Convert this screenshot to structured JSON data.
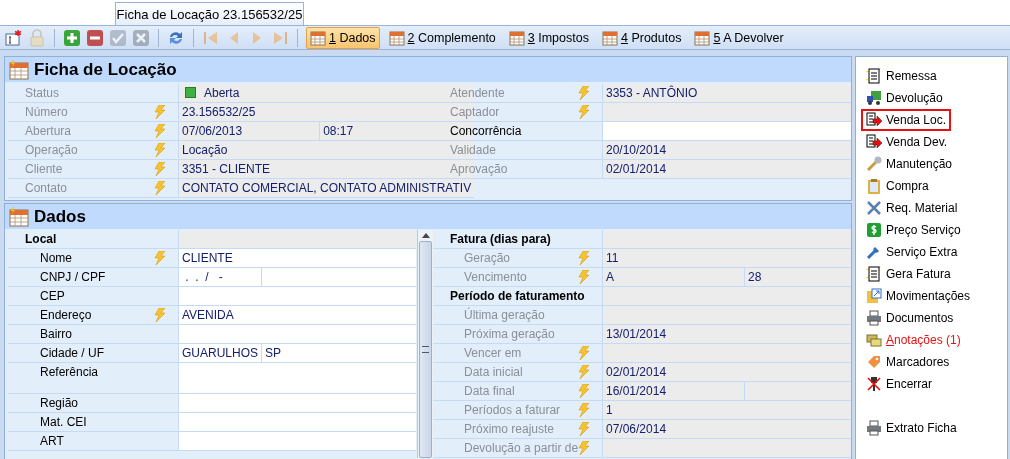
{
  "window": {
    "title": "Ficha de Locação 23.156532/25"
  },
  "toolbar": {
    "groups": [
      [
        {
          "kind": "new",
          "disabled": false
        },
        {
          "kind": "lock",
          "disabled": true
        }
      ],
      [
        {
          "kind": "add",
          "disabled": false
        },
        {
          "kind": "remove",
          "disabled": false
        },
        {
          "kind": "confirm",
          "disabled": true
        },
        {
          "kind": "cancel",
          "disabled": true
        }
      ],
      [
        {
          "kind": "refresh",
          "disabled": false
        }
      ],
      [
        {
          "kind": "first",
          "disabled": true
        },
        {
          "kind": "prev",
          "disabled": true
        },
        {
          "kind": "next",
          "disabled": true
        },
        {
          "kind": "last",
          "disabled": true
        }
      ]
    ]
  },
  "tabs": [
    {
      "label": "1 Dados",
      "selected": true
    },
    {
      "label": "2 Complemento",
      "selected": false
    },
    {
      "label": "3 Impostos",
      "selected": false
    },
    {
      "label": "4 Produtos",
      "selected": false
    },
    {
      "label": "5 A Devolver",
      "selected": false
    }
  ],
  "sections": [
    {
      "title": "Ficha de Locação",
      "left": [
        {
          "label": "Status",
          "value": "Aberta",
          "color": "#3cb043",
          "editable": false
        },
        {
          "label": "Número",
          "bolt": true,
          "value": "23.156532/25",
          "editable": false
        },
        {
          "label": "Abertura",
          "bolt": true,
          "value": "07/06/2013",
          "split": true,
          "value2": "08:17",
          "editable": false
        },
        {
          "label": "Operação",
          "bolt": true,
          "value": "Locação",
          "editable": false
        },
        {
          "label": "Cliente",
          "bolt": true,
          "value": "3351 - CLIENTE",
          "editable": false
        },
        {
          "label": "Contato",
          "bolt": true,
          "value": "CONTATO COMERCIAL, CONTATO ADMINISTRATIV",
          "editable": false
        }
      ],
      "right": [
        {
          "label": "Atendente",
          "bolt": true,
          "value": "3353 - ANTÔNIO",
          "editable": false
        },
        {
          "label": "Captador",
          "bolt": true,
          "editable": false
        },
        {
          "label": "Concorrência",
          "editable": true
        },
        {
          "label": "Validade",
          "value": "20/10/2014",
          "editable": false
        },
        {
          "label": "Aprovação",
          "value": "02/01/2014",
          "editable": false
        }
      ]
    },
    {
      "title": "Dados",
      "scrollbar": true,
      "left": [
        {
          "kind": "group",
          "label": "Local"
        },
        {
          "label": "Nome",
          "bolt": true,
          "value": "CLIENTE",
          "editable": true
        },
        {
          "label": "CNPJ / CPF",
          "value": " .  .  /   -",
          "split": true,
          "editable": true
        },
        {
          "label": "CEP",
          "editable": true
        },
        {
          "label": "Endereço",
          "bolt": true,
          "value": "AVENIDA",
          "editable": true
        },
        {
          "label": "Bairro",
          "editable": true
        },
        {
          "label": "Cidade / UF",
          "value": "GUARULHOS",
          "split": true,
          "value2": "SP",
          "editable": true
        },
        {
          "label": "Referência",
          "multiline": true,
          "editable": true
        },
        {
          "label": "Região",
          "editable": true
        },
        {
          "label": "Mat. CEI",
          "editable": true
        },
        {
          "label": "ART",
          "editable": true
        }
      ],
      "right": [
        {
          "kind": "group",
          "label": "Fatura (dias para)"
        },
        {
          "label": "Geração",
          "bolt": true,
          "value": "11",
          "editable": false
        },
        {
          "label": "Vencimento",
          "bolt": true,
          "value": "A",
          "split": true,
          "value2": "28",
          "editable": false
        },
        {
          "kind": "group",
          "label": "Período de faturamento"
        },
        {
          "label": "Última geração",
          "editable": false
        },
        {
          "label": "Próxima geração",
          "value": "13/01/2014",
          "editable": false
        },
        {
          "label": "Vencer em",
          "bolt": true,
          "editable": false
        },
        {
          "label": "Data inicial",
          "bolt": true,
          "value": "02/01/2014",
          "editable": false
        },
        {
          "label": "Data final",
          "bolt": true,
          "value": "16/01/2014",
          "split": true,
          "editable": false
        },
        {
          "label": "Períodos a faturar",
          "bolt": true,
          "value": "1",
          "editable": false
        },
        {
          "label": "Próximo reajuste",
          "bolt": true,
          "value": "07/06/2014",
          "editable": false
        },
        {
          "label": "Devolução a partir de",
          "bolt": true,
          "editable": false
        }
      ]
    }
  ],
  "sidebar": {
    "items": [
      {
        "kind": "shipment",
        "label": "Remessa",
        "selected": false,
        "alert": false
      },
      {
        "kind": "return",
        "label": "Devolução",
        "selected": false,
        "alert": false
      },
      {
        "kind": "sale",
        "label": "Venda Loc.",
        "selected": true,
        "alert": false
      },
      {
        "kind": "sale",
        "label": "Venda Dev.",
        "selected": false,
        "alert": false
      },
      {
        "kind": "maintenance",
        "label": "Manutenção",
        "selected": false,
        "alert": false
      },
      {
        "kind": "purchase",
        "label": "Compra",
        "selected": false,
        "alert": false
      },
      {
        "kind": "request",
        "label": "Req. Material",
        "selected": false,
        "alert": false
      },
      {
        "kind": "price",
        "label": "Preço Serviço",
        "selected": false,
        "alert": false
      },
      {
        "kind": "service",
        "label": "Serviço Extra",
        "selected": false,
        "alert": false
      },
      {
        "kind": "invoice",
        "label": "Gera Fatura",
        "selected": false,
        "alert": false
      },
      {
        "kind": "movements",
        "label": "Movimentações",
        "selected": false,
        "alert": false
      },
      {
        "kind": "documents",
        "label": "Documentos",
        "selected": false,
        "alert": false
      },
      {
        "kind": "notes",
        "label": "Anotações (1)",
        "selected": false,
        "alert": true
      },
      {
        "kind": "tags",
        "label": "Marcadores",
        "selected": false,
        "alert": false
      },
      {
        "kind": "close",
        "label": "Encerrar",
        "selected": false,
        "alert": false
      }
    ],
    "footer_items": [
      {
        "kind": "documents",
        "label": "Extrato Ficha",
        "selected": false,
        "alert": false
      }
    ]
  }
}
